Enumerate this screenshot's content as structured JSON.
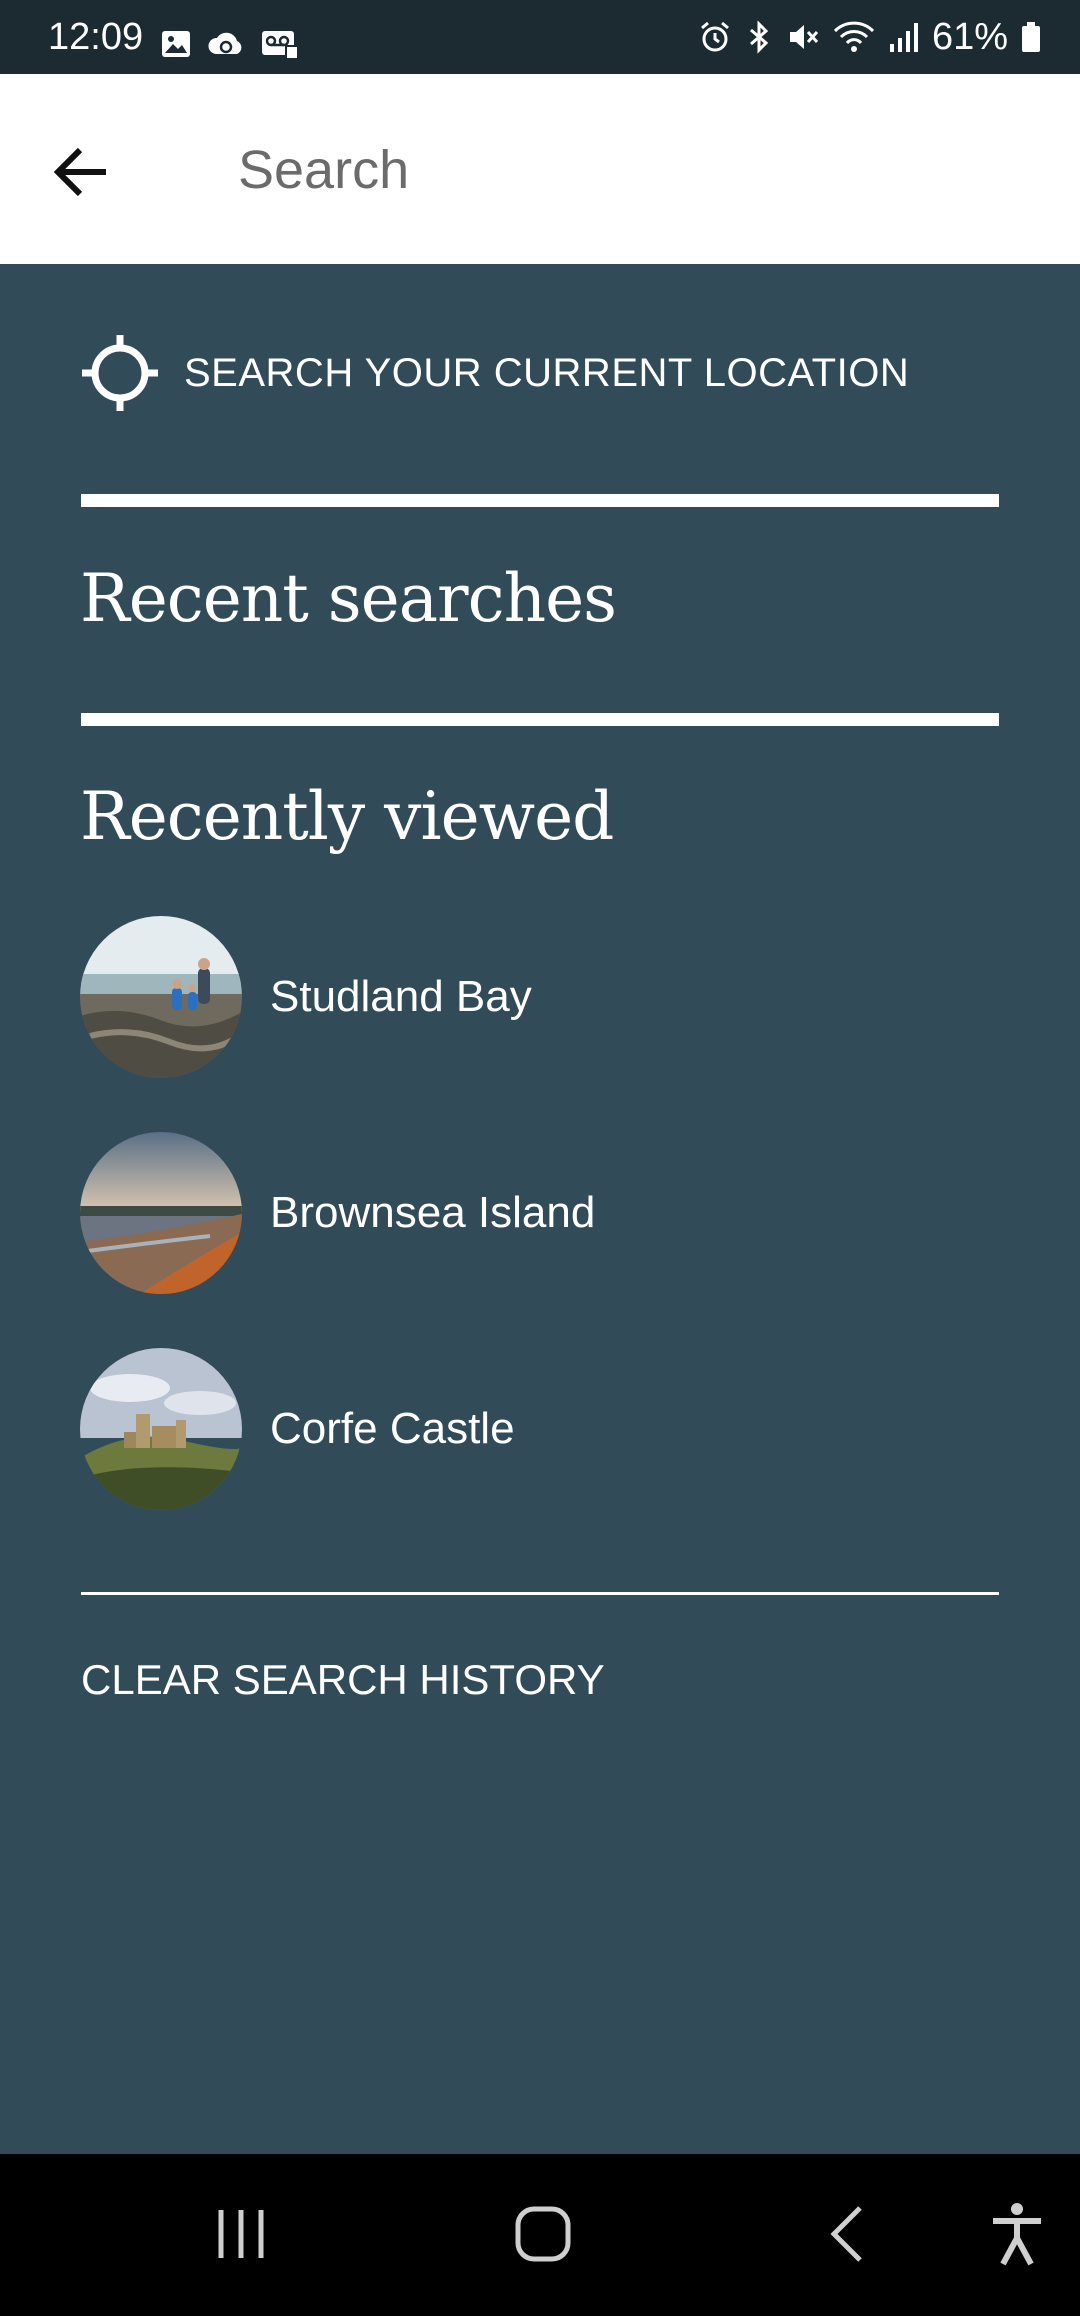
{
  "status_bar": {
    "time": "12:09",
    "battery": "61%"
  },
  "search": {
    "placeholder": "Search",
    "value": ""
  },
  "current_location": {
    "label": "SEARCH YOUR CURRENT LOCATION"
  },
  "recent_searches": {
    "heading": "Recent searches"
  },
  "recently_viewed": {
    "heading": "Recently viewed",
    "items": [
      {
        "label": "Studland Bay"
      },
      {
        "label": "Brownsea Island"
      },
      {
        "label": "Corfe Castle"
      }
    ]
  },
  "clear_history": {
    "label": "CLEAR SEARCH HISTORY"
  },
  "colors": {
    "background": "#324b58",
    "status_bar": "#1c2a32",
    "header": "#ffffff",
    "nav_bar": "#000000"
  }
}
